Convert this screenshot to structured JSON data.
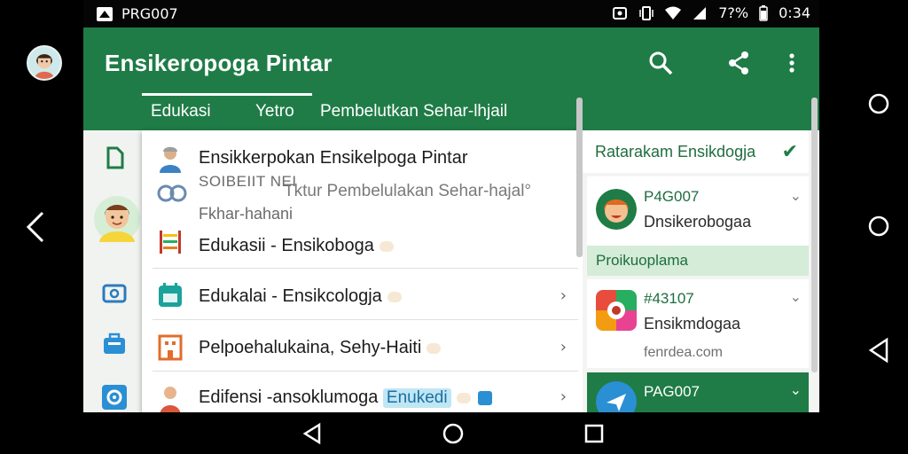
{
  "status_bar": {
    "app_name": "PRG007",
    "battery": "7?%",
    "time": "0:34",
    "icons": [
      "app-notification-icon",
      "cast-icon",
      "vibrate-icon",
      "wifi-icon",
      "signal-icon",
      "battery-icon"
    ]
  },
  "app_bar": {
    "title": "Ensikeropoga Pintar",
    "actions": [
      "search-icon",
      "share-icon",
      "more-vert-icon"
    ]
  },
  "tabs": [
    {
      "label": "Edukasi",
      "selected": true
    },
    {
      "label": "Yetro",
      "selected": true
    },
    {
      "label": "Pembelutkan Sehar-lhjail",
      "selected": false
    }
  ],
  "dropdown": {
    "rows": [
      {
        "icon": "person-icon",
        "title": "Ensikkerpokan Ensikelpoga Pintar",
        "line2": "SOIBEIIT NEI",
        "line2b": "Tktur Pembelulakan Sehar-hajal°",
        "line3": "Fkhar-hahani",
        "chevron": false
      },
      {
        "icon": "abacus-icon",
        "title": "Edukasii - Ensikoboga",
        "chevron": false
      },
      {
        "icon": "calendar-icon",
        "title": "Edukalai - Ensikcologja",
        "chevron": true
      },
      {
        "icon": "building-icon",
        "title": "Pelpoehalukaina, Sehy-Haiti",
        "chevron": true
      },
      {
        "icon": "doctor-icon",
        "title": "Edifensi -ansoklumoga",
        "badge": "Enukedi",
        "chevron": true
      }
    ]
  },
  "left_column_icons": [
    "doc-icon",
    "child-avatar-icon",
    "camera-icon",
    "briefcase-icon",
    "gear-bug-icon"
  ],
  "right_column": {
    "header": "Ratarakam Ensikdogja",
    "section": "Proikuoplama",
    "cards": [
      {
        "icon": "female-avatar-icon",
        "line1": "P4G007",
        "line2": "Dnsikerobogaa",
        "line3": ""
      },
      {
        "icon": "colorful-app-icon",
        "line1": "#43107",
        "line2": "Ensikmdogaa",
        "line3": "fenrdea.com"
      },
      {
        "icon": "plane-icon",
        "line1": "PAG007",
        "line2": "",
        "line3": ""
      }
    ]
  },
  "system_nav": [
    "back-icon",
    "home-icon",
    "recents-icon"
  ],
  "colors": {
    "primary": "#1f7c46",
    "section": "#d4ecd8",
    "text": "#1b1b1b"
  }
}
